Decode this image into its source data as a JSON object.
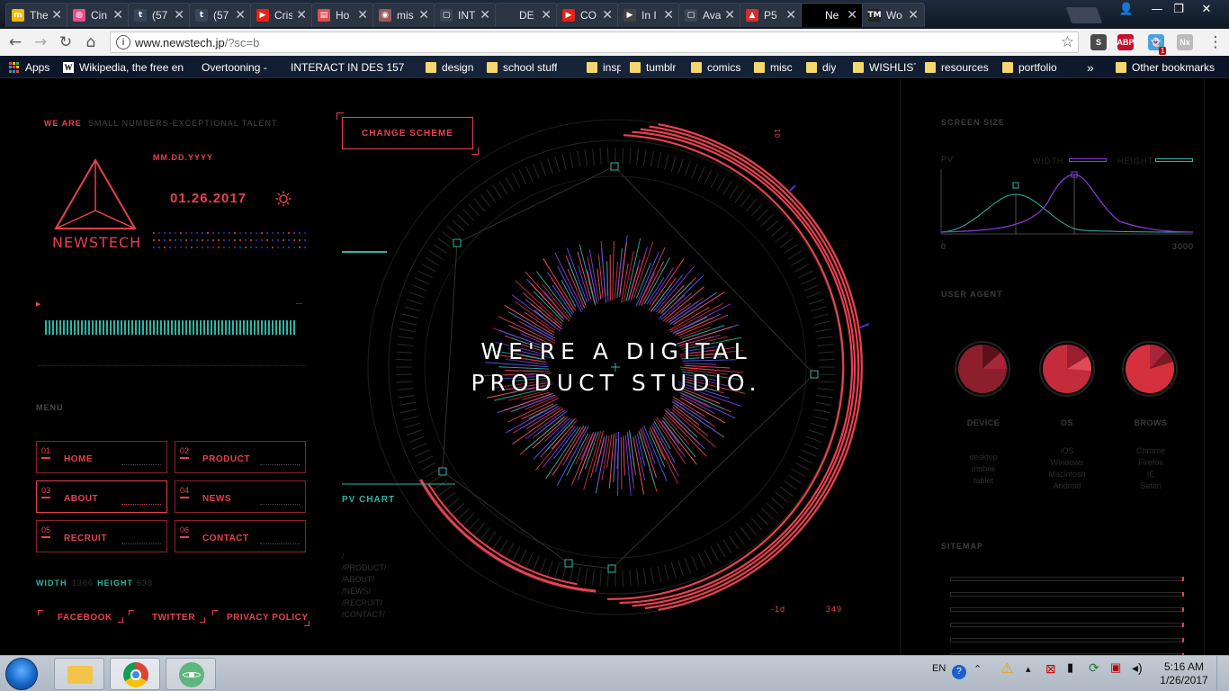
{
  "browser": {
    "tabs": [
      {
        "title": "The",
        "fav_text": "m",
        "fav_color": "#f5b800"
      },
      {
        "title": "Cin",
        "fav_text": "◍",
        "fav_color": "#ea4c89"
      },
      {
        "title": "(57",
        "fav_text": "t",
        "fav_color": "#36465d"
      },
      {
        "title": "(57",
        "fav_text": "t",
        "fav_color": "#36465d"
      },
      {
        "title": "Cris",
        "fav_text": "▶",
        "fav_color": "#e62117"
      },
      {
        "title": "Ho",
        "fav_text": "▤",
        "fav_color": "#e04b4b"
      },
      {
        "title": "mis",
        "fav_text": "◉",
        "fav_color": "#9a5b5b"
      },
      {
        "title": "INT",
        "fav_text": "▢",
        "fav_color": "#3a4556"
      },
      {
        "title": "DE",
        "fav_text": "",
        "fav_color": "#2b3442"
      },
      {
        "title": "CO",
        "fav_text": "▶",
        "fav_color": "#e62117"
      },
      {
        "title": "In I",
        "fav_text": "▶",
        "fav_color": "#444"
      },
      {
        "title": "Ava",
        "fav_text": "▢",
        "fav_color": "#3a4556"
      },
      {
        "title": "P5",
        "fav_text": "▲",
        "fav_color": "#d32f2f"
      },
      {
        "title": "Ne",
        "fav_text": "",
        "fav_color": "#000"
      },
      {
        "title": "Wo",
        "fav_text": "TM",
        "fav_color": "#222"
      }
    ],
    "url_host": "www.newstech.jp",
    "url_path": "/?sc=b",
    "bookmarks": [
      {
        "label": "Apps",
        "type": "apps"
      },
      {
        "label": "Wikipedia, the free en",
        "type": "wiki"
      },
      {
        "label": "Overtooning -",
        "type": "page"
      },
      {
        "label": "INTERACT IN DES 157",
        "type": "page"
      },
      {
        "label": "design",
        "type": "folder"
      },
      {
        "label": "school stuff",
        "type": "folder"
      },
      {
        "label": "inspo",
        "type": "folder"
      },
      {
        "label": "tumblr",
        "type": "folder"
      },
      {
        "label": "comics",
        "type": "folder"
      },
      {
        "label": "misc",
        "type": "folder"
      },
      {
        "label": "diy",
        "type": "folder"
      },
      {
        "label": "WISHLIST",
        "type": "folder"
      },
      {
        "label": "resources",
        "type": "folder"
      },
      {
        "label": "portfolio",
        "type": "folder"
      }
    ],
    "bookmarks_overflow": "»",
    "other_bookmarks": "Other bookmarks",
    "extensions": [
      {
        "text": "S",
        "color": "#4a4a4a"
      },
      {
        "text": "ABP",
        "color": "#c70d2c"
      },
      {
        "text": "👻",
        "color": "#4aa3df"
      },
      {
        "text": "Nx",
        "color": "#bbb"
      }
    ],
    "notification_badge": "1"
  },
  "site": {
    "we_are": "WE ARE",
    "tagline": "SMALL NUMBERS-EXCEPTIONAL TALENT.",
    "logo": "NEWSTECH",
    "date_format": "MM.DD.YYYY",
    "date": "01.26.2017",
    "menu_title": "MENU",
    "menu": [
      {
        "num": "01",
        "label": "HOME"
      },
      {
        "num": "02",
        "label": "PRODUCT"
      },
      {
        "num": "03",
        "label": "ABOUT"
      },
      {
        "num": "04",
        "label": "NEWS"
      },
      {
        "num": "05",
        "label": "RECRUIT"
      },
      {
        "num": "06",
        "label": "CONTACT"
      }
    ],
    "width_label": "WIDTH",
    "width_value": "1366",
    "height_label": "HEIGHT",
    "height_value": "638",
    "social": [
      "FACEBOOK",
      "TWITTER",
      "PRIVACY POLICY"
    ],
    "change_scheme": "CHANGE SCHEME",
    "hero_line1": "WE'RE A DIGITAL",
    "hero_line2": "PRODUCT STUDIO.",
    "pv_chart": "PV CHART",
    "sitemap_paths": [
      "/",
      "/PRODUCT/",
      "/ABOUT/",
      "/NEWS/",
      "/RECRUIT/",
      "/CONTACT/"
    ],
    "ring_top_value": "10",
    "ring_bottom_left": "-1d",
    "ring_bottom_right": "349",
    "screen_size": "SCREEN SIZE",
    "pv_label": "PV",
    "legend_width": "WIDTH",
    "legend_height": "HEIGHT",
    "axis_min": "0",
    "axis_max": "3000",
    "user_agent": "USER AGENT",
    "ua": [
      {
        "label": "DEVICE",
        "items": [
          "desktop",
          "mobile",
          "tablet"
        ]
      },
      {
        "label": "OS",
        "items": [
          "iOS",
          "Windows",
          "Macintosh",
          "Android"
        ]
      },
      {
        "label": "BROWS",
        "items": [
          "Chrome",
          "Firefox",
          "IE",
          "Safari"
        ]
      }
    ],
    "sitemap": "SITEMAP"
  },
  "taskbar": {
    "lang": "EN",
    "time": "5:16 AM",
    "date": "1/26/2017"
  },
  "colors": {
    "accent_red": "#e8414e",
    "accent_teal": "#2fb4a3",
    "accent_purple": "#8a3bd8"
  }
}
